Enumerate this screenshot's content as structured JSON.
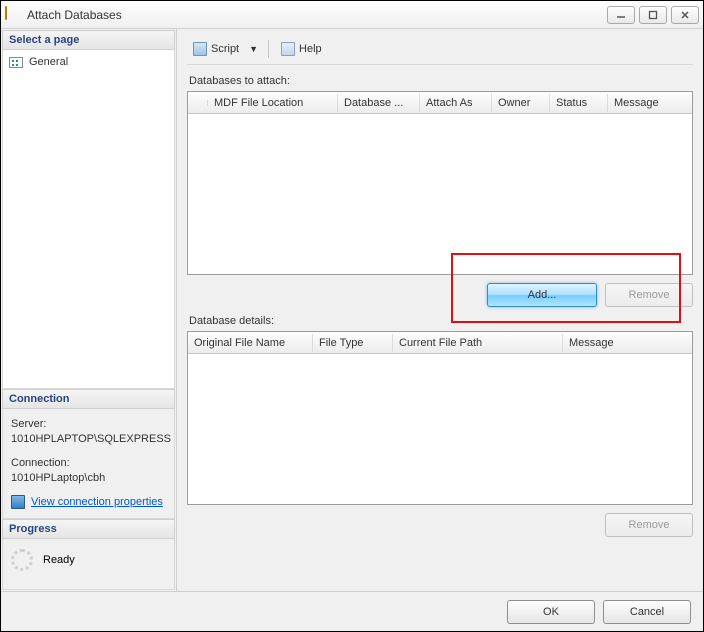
{
  "window": {
    "title": "Attach Databases"
  },
  "sidebar": {
    "selectPage": "Select a page",
    "general": "General",
    "connectionHead": "Connection",
    "serverLabel": "Server:",
    "serverValue": "1010HPLAPTOP\\SQLEXPRESS",
    "connLabel": "Connection:",
    "connValue": "1010HPLaptop\\cbh",
    "viewProps": "View connection properties",
    "progressHead": "Progress",
    "progressState": "Ready"
  },
  "toolbar": {
    "script": "Script",
    "help": "Help"
  },
  "main": {
    "attachLabel": "Databases to attach:",
    "attachCols": [
      "MDF File Location",
      "Database ...",
      "Attach As",
      "Owner",
      "Status",
      "Message"
    ],
    "addBtn": "Add...",
    "removeBtn": "Remove",
    "detailsLabel": "Database details:",
    "detailsCols": [
      "Original File Name",
      "File Type",
      "Current File Path",
      "Message"
    ],
    "removeBtn2": "Remove"
  },
  "footer": {
    "ok": "OK",
    "cancel": "Cancel"
  }
}
